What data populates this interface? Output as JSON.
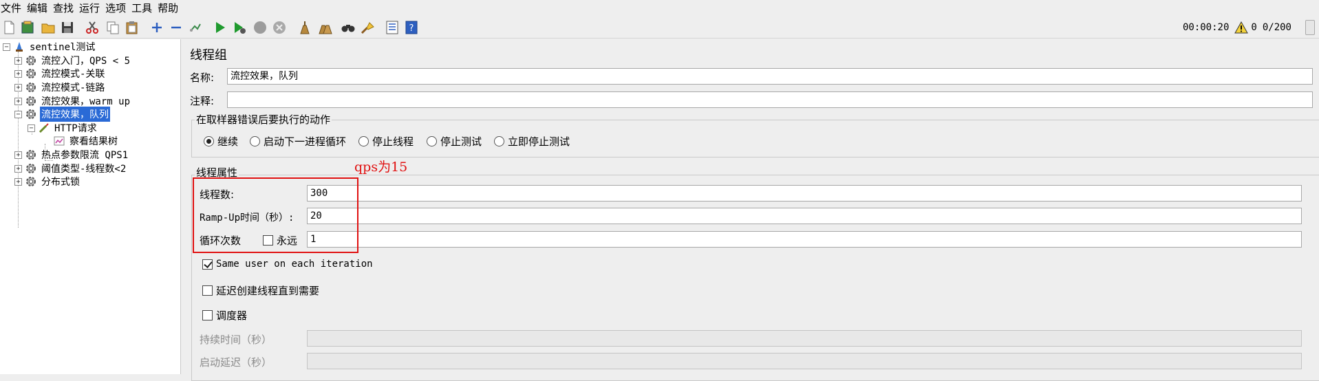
{
  "menu": [
    "文件",
    "编辑",
    "查找",
    "运行",
    "选项",
    "工具",
    "帮助"
  ],
  "status": {
    "elapsed": "00:00:20",
    "warnings": "0",
    "threads": "0/200"
  },
  "colors": {
    "selection": "#2a6ad6",
    "annotation": "#e01010",
    "run_green": "#1f9a2e"
  },
  "toolbar_icons": [
    "new-icon",
    "templates-icon",
    "open-icon",
    "save-icon",
    "cut-icon",
    "copy-icon",
    "paste-icon",
    "expand-icon",
    "collapse-icon",
    "toggle-icon",
    "start-icon",
    "start-no-pause-icon",
    "stop-icon",
    "shutdown-icon",
    "clear-icon",
    "clear-all-icon",
    "search-icon",
    "reset-search-icon",
    "function-helper-icon",
    "help-icon"
  ],
  "tree": {
    "root": "sentinel测试",
    "items": [
      "流控入门，QPS < 5",
      "流控模式-关联",
      "流控模式-链路",
      "流控效果，warm up",
      "流控效果，队列",
      "HTTP请求",
      "察看结果树",
      "热点参数限流 QPS1",
      "阈值类型-线程数<2",
      "分布式锁"
    ],
    "selected_index": 4
  },
  "panel": {
    "title": "线程组",
    "name_label": "名称:",
    "name_value": "流控效果，队列",
    "comment_label": "注释:",
    "comment_value": "",
    "error_group_title": "在取样器错误后要执行的动作",
    "error_actions": [
      "继续",
      "启动下一进程循环",
      "停止线程",
      "停止测试",
      "立即停止测试"
    ],
    "error_action_selected": 0,
    "props_group_title": "线程属性",
    "threads_label": "线程数:",
    "threads_value": "300",
    "rampup_label": "Ramp-Up时间（秒）:",
    "rampup_value": "20",
    "loop_label": "循环次数",
    "forever_label": "永远",
    "forever_checked": false,
    "loop_value": "1",
    "same_user_label": "Same user on each iteration",
    "same_user_checked": true,
    "delay_label": "延迟创建线程直到需要",
    "delay_checked": false,
    "scheduler_label": "调度器",
    "scheduler_checked": false,
    "duration_label": "持续时间（秒）",
    "startup_delay_label": "启动延迟（秒）",
    "annotation": "qps为15"
  }
}
